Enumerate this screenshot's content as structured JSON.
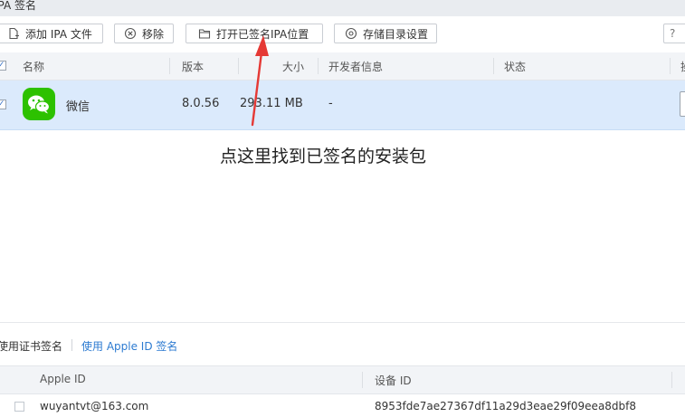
{
  "window": {
    "title": "IPA 签名"
  },
  "toolbar": {
    "add_label": "添加 IPA 文件",
    "remove_label": "移除",
    "open_signed_label": "打开已签名IPA位置",
    "storage_settings_label": "存储目录设置",
    "help_label": "?"
  },
  "table": {
    "columns": [
      "名称",
      "版本",
      "大小",
      "开发者信息",
      "状态",
      "操"
    ],
    "rows": [
      {
        "name": "微信",
        "version": "8.0.56",
        "size": "293.11 MB",
        "developer": "-"
      }
    ]
  },
  "annotation": {
    "text": "点这里找到已签名的安装包",
    "arrow_color": "#e53935"
  },
  "signing_tabs": {
    "cert_tab": "使用证书签名",
    "appleid_tab": "使用 Apple ID 签名"
  },
  "apple_id_table": {
    "columns": [
      "Apple ID",
      "设备 ID"
    ],
    "rows": [
      {
        "apple_id": "wuyantvt@163.com",
        "device_id": "8953fde7ae27367df11a29d3eae29f09eea8dbf8"
      }
    ]
  },
  "colors": {
    "accent": "#2d7bd1",
    "selected_row": "#dbeafc",
    "header_bg": "#f2f4f7",
    "wechat_green": "#2dc100"
  },
  "icons": {
    "add": "file-plus-icon",
    "remove": "circle-x-icon",
    "open": "folder-open-icon",
    "settings": "gear-icon",
    "app": "wechat-icon"
  }
}
